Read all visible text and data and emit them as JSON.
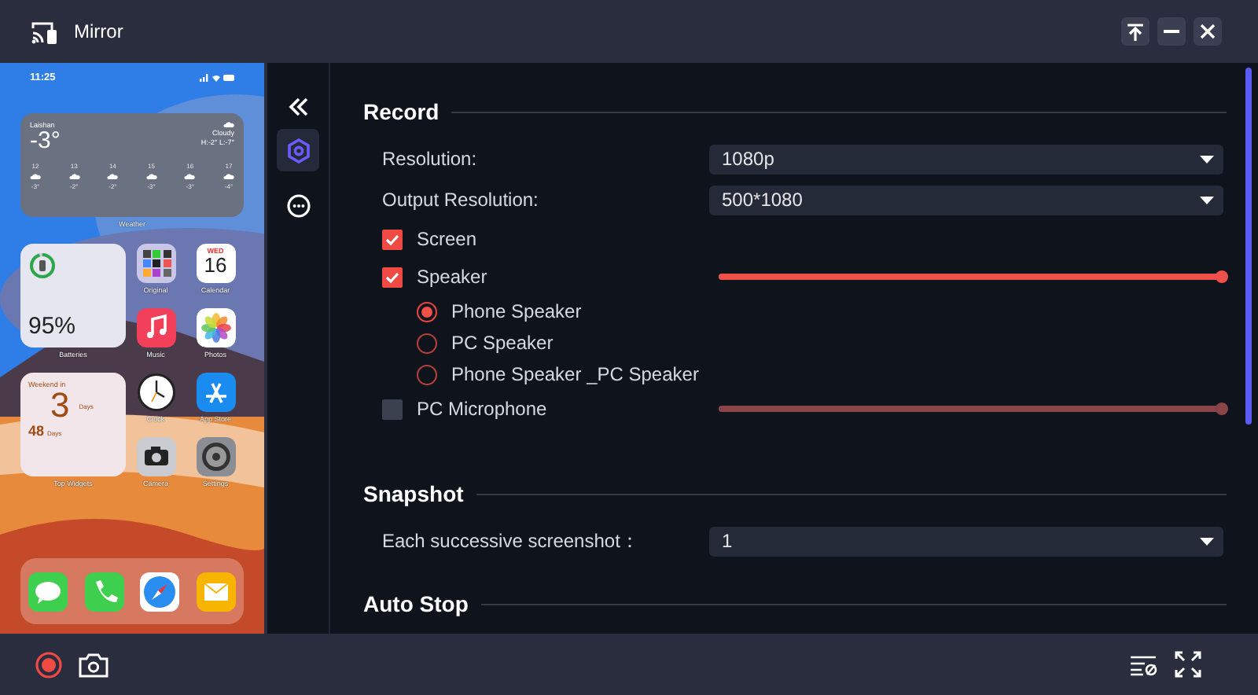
{
  "window": {
    "title": "Mirror"
  },
  "phone": {
    "status_time": "11:25",
    "weather": {
      "location": "Laishan",
      "temp": "-3°",
      "condition": "Cloudy",
      "range": "H:-2° L:-7°",
      "label": "Weather",
      "hours": [
        {
          "hour": "12",
          "temp": "-3°"
        },
        {
          "hour": "13",
          "temp": "-2°"
        },
        {
          "hour": "14",
          "temp": "-2°"
        },
        {
          "hour": "15",
          "temp": "-3°"
        },
        {
          "hour": "16",
          "temp": "-3°"
        },
        {
          "hour": "17",
          "temp": "-4°"
        }
      ]
    },
    "battery": {
      "level": 0.95,
      "percent": "95%",
      "label": "Batteries"
    },
    "calendar_icon": {
      "day": "WED",
      "date": "16"
    },
    "apps": [
      {
        "kind": "folder",
        "label": "Original"
      },
      {
        "kind": "calendar",
        "label": "Calendar"
      },
      {
        "kind": "music",
        "label": "Music"
      },
      {
        "kind": "photos",
        "label": "Photos"
      },
      {
        "kind": "clock",
        "label": "Clock"
      },
      {
        "kind": "appstore",
        "label": "App Store"
      },
      {
        "kind": "camera",
        "label": "Camera"
      },
      {
        "kind": "settings",
        "label": "Settings"
      }
    ],
    "countdown": {
      "title": "Weekend in",
      "number": "3",
      "unit": "Days",
      "count": "48",
      "count_unit": "Days",
      "label": "Top Widgets"
    },
    "dock": [
      {
        "kind": "messages"
      },
      {
        "kind": "phone"
      },
      {
        "kind": "safari"
      },
      {
        "kind": "mail"
      }
    ]
  },
  "nav": [
    {
      "kind": "settings",
      "selected": true
    },
    {
      "kind": "more",
      "selected": false
    }
  ],
  "sections": [
    {
      "title": "Record",
      "rows": [
        {
          "kind": "select",
          "label": "Resolution:",
          "value": "1080p"
        },
        {
          "kind": "select",
          "label": "Output Resolution:",
          "value": "500*1080"
        },
        {
          "kind": "checkbox",
          "label": "Screen",
          "checked": true
        },
        {
          "kind": "checkbox",
          "label": "Speaker",
          "checked": true,
          "level": 1
        },
        {
          "kind": "radio",
          "label": "Phone Speaker",
          "selected": true
        },
        {
          "kind": "radio",
          "label": "PC Speaker",
          "selected": false
        },
        {
          "kind": "radio",
          "label": "Phone Speaker _PC Speaker",
          "selected": false
        },
        {
          "kind": "checkbox",
          "label": "PC Microphone",
          "checked": false,
          "level": 1
        }
      ]
    },
    {
      "title": "Snapshot",
      "rows": [
        {
          "kind": "select",
          "label": "Each successive screenshot：",
          "value": "1"
        }
      ]
    },
    {
      "title": "Auto Stop"
    }
  ]
}
